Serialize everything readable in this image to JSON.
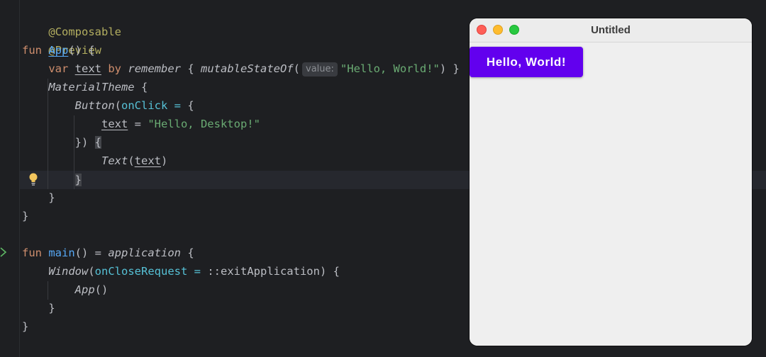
{
  "editor": {
    "lines": {
      "l1": {
        "ann": "@Composable"
      },
      "l2": {
        "ann": "@Preview"
      },
      "l3": {
        "kw": "fun",
        "name": "App",
        "rest": "() {"
      },
      "l4": {
        "kw": "var",
        "prop": "text",
        "by": "by",
        "remember": "remember",
        "open": " { ",
        "msof": "mutableStateOf",
        "paren": "(",
        "hint": "value:",
        "str": "\"Hello, World!\"",
        "close": ") }"
      },
      "l5": {
        "fn": "MaterialTheme",
        "rest": " {"
      },
      "l6": {
        "fn": "Button",
        "paren": "(",
        "param": "onClick",
        "eq": " = ",
        "rest": "{"
      },
      "l7": {
        "prop": "text",
        "eq": " = ",
        "str": "\"Hello, Desktop!\""
      },
      "l8": {
        "pre": "}) ",
        "brace": "{"
      },
      "l9": {
        "fn": "Text",
        "open": "(",
        "prop": "text",
        "close": ")"
      },
      "l10": {
        "brace": "}"
      },
      "l11": {
        "text": "}"
      },
      "l12": {
        "text": "}"
      },
      "l14": {
        "kw": "fun",
        "name": "main",
        "mid": "() = ",
        "app": "application",
        "rest": " {"
      },
      "l15": {
        "fn": "Window",
        "paren": "(",
        "param": "onCloseRequest",
        "eq": " = ",
        "rest": "::exitApplication) {"
      },
      "l16": {
        "fn": "App",
        "rest": "()"
      },
      "l17": {
        "text": "}"
      },
      "l18": {
        "text": "}"
      }
    },
    "icons": {
      "bulb": "lightbulb-icon",
      "run": "run-gutter-icon"
    },
    "colors": {
      "background": "#1e1f22",
      "keyword": "#cf8e6d",
      "annotation": "#b3ae60",
      "function": "#56a8f5",
      "string": "#6aab73",
      "parameter": "#56c1d6",
      "text": "#bcbec4"
    }
  },
  "window": {
    "title": "Untitled",
    "button_label": "Hello, World!",
    "colors": {
      "button": "#6200ee",
      "close": "#fe5f57",
      "minimize": "#febc2e",
      "maximize": "#28c840"
    }
  }
}
